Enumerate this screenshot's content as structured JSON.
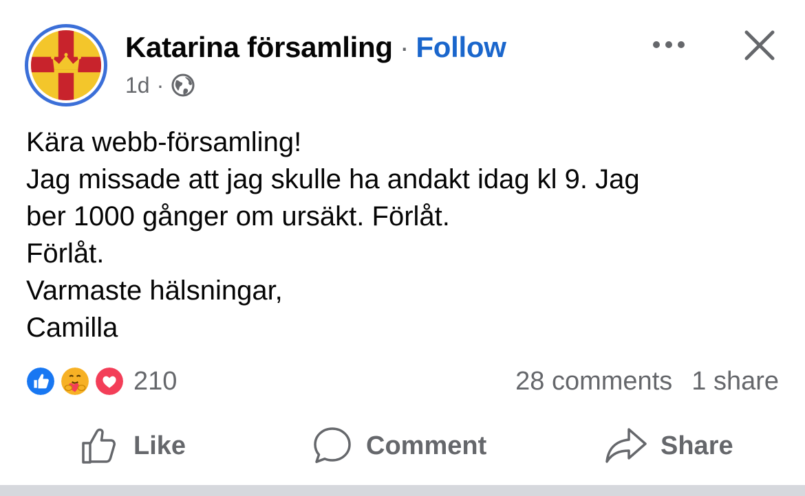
{
  "header": {
    "page_name": "Katarina församling",
    "separator": "·",
    "follow_label": "Follow",
    "time_ago": "1d",
    "meta_separator": "·",
    "audience_icon": "globe-icon",
    "more_icon": "more-horizontal-icon",
    "close_icon": "close-icon"
  },
  "avatar": {
    "icon": "church-crown-cross-logo",
    "colors": {
      "ring": "#3b6fd8",
      "field": "#f3c62b",
      "cross": "#c8232c",
      "crown": "#f3c62b"
    }
  },
  "post": {
    "lines": [
      "Kära webb-församling!",
      "Jag missade att jag skulle ha andakt idag kl 9. Jag",
      "ber 1000 gånger om ursäkt. Förlåt.",
      "Förlåt.",
      "Varmaste hälsningar,",
      "Camilla"
    ]
  },
  "reactions": {
    "icons": [
      "like-reaction-icon",
      "care-reaction-icon",
      "love-reaction-icon"
    ],
    "count": "210",
    "comments": "28 comments",
    "shares": "1 share"
  },
  "actions": {
    "like_label": "Like",
    "comment_label": "Comment",
    "share_label": "Share"
  },
  "colors": {
    "follow": "#1a66cc",
    "secondary_text": "#65676b",
    "like_blue": "#1877f2",
    "love_red": "#f33e58",
    "care_yellow": "#f7b125"
  }
}
